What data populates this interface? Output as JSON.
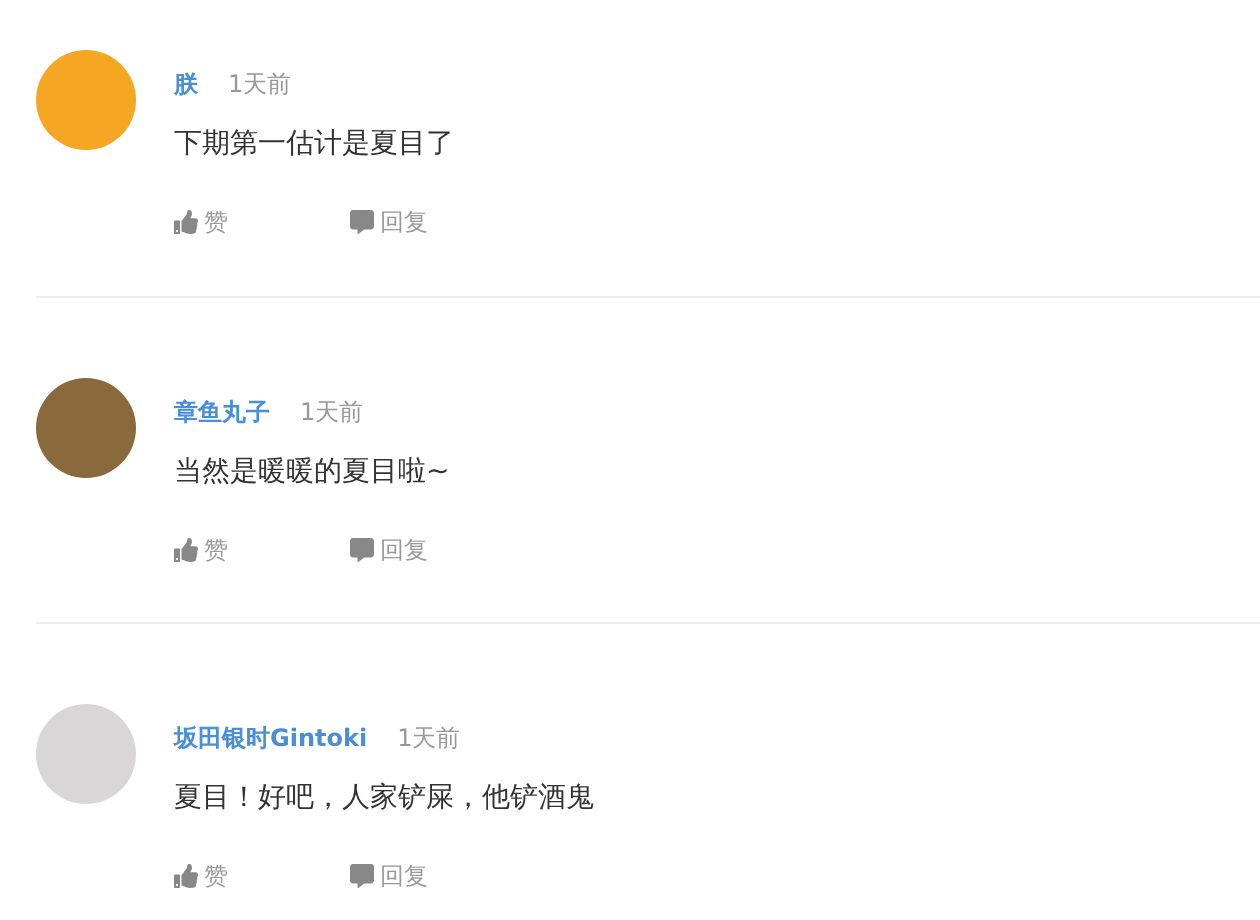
{
  "comments": [
    {
      "author": "朕",
      "time": "1天前",
      "text": "下期第一估计是夏目了",
      "like_label": "赞",
      "reply_label": "回复"
    },
    {
      "author": "章鱼丸子",
      "time": "1天前",
      "text": "当然是暖暖的夏目啦~",
      "like_label": "赞",
      "reply_label": "回复"
    },
    {
      "author": "坂田银时Gintoki",
      "time": "1天前",
      "text": "夏目！好吧，人家铲屎，他铲酒鬼",
      "like_label": "赞",
      "reply_label": "回复"
    }
  ]
}
